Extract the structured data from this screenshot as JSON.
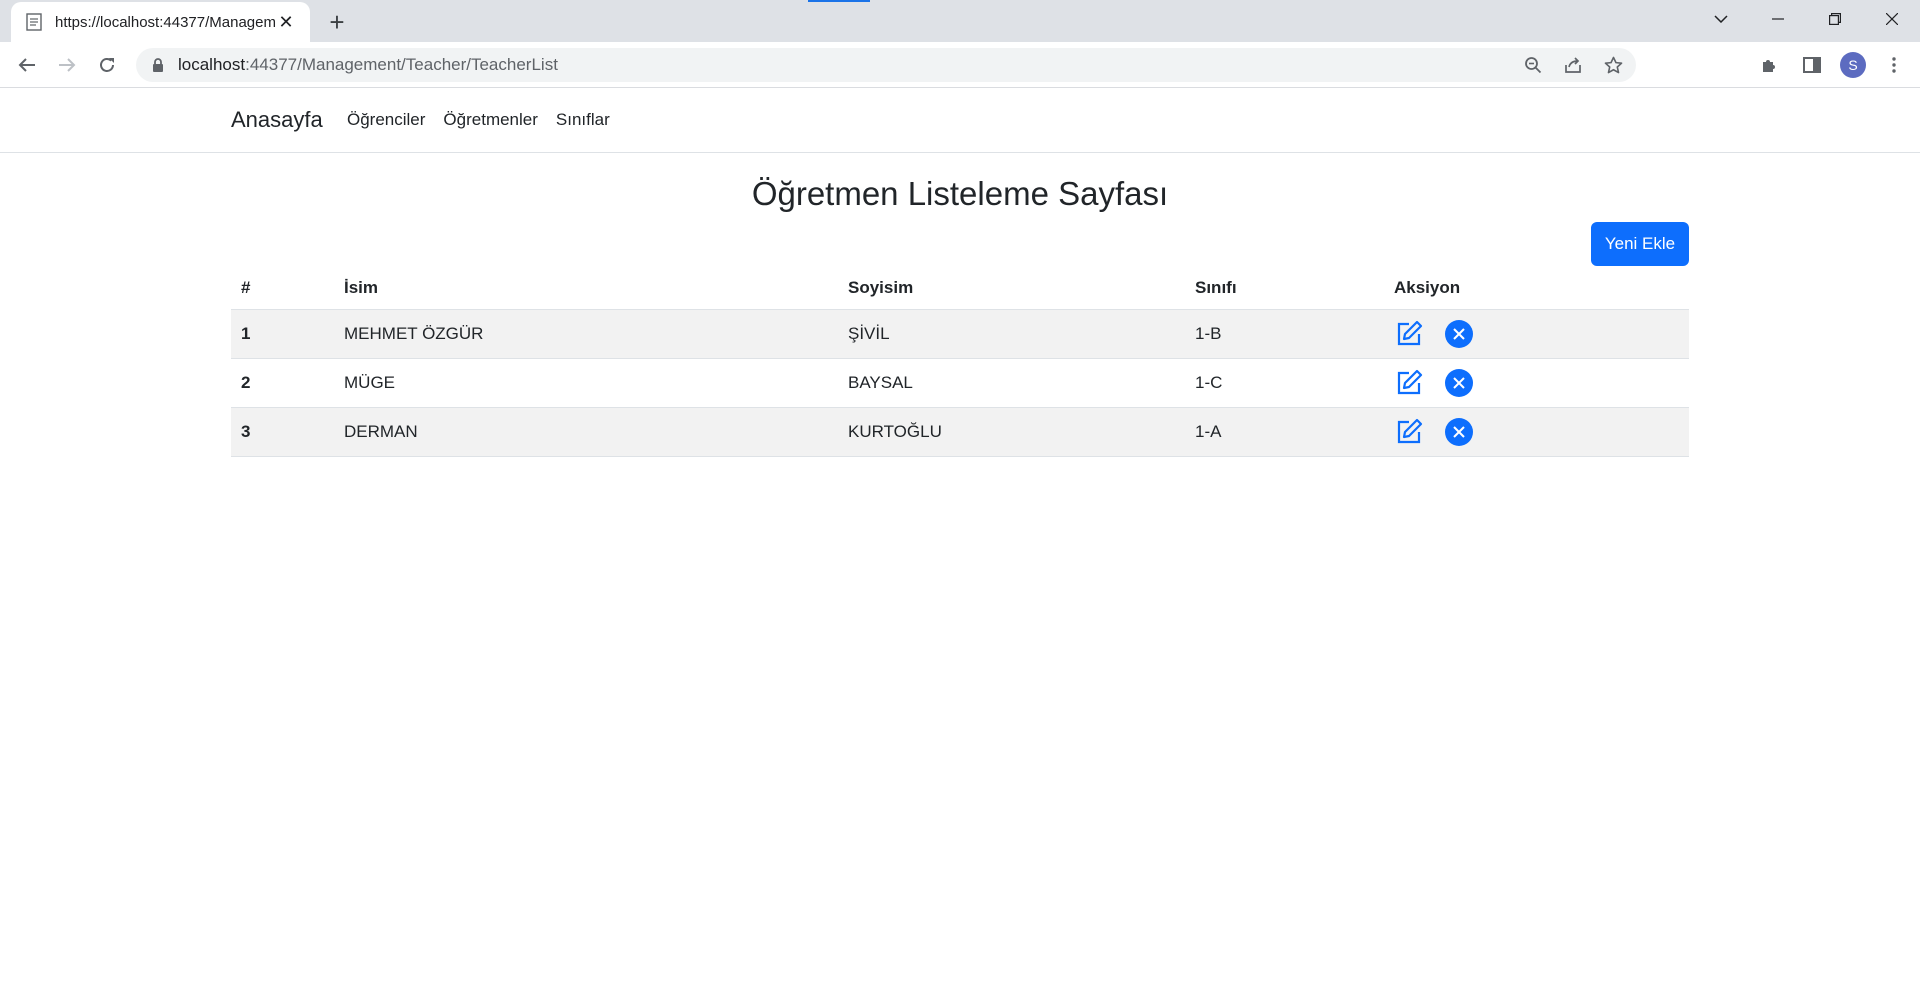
{
  "browser": {
    "tab_title": "https://localhost:44377/Management/Teacher/TeacherList",
    "url_host": "localhost",
    "url_path": ":44377/Management/Teacher/TeacherList",
    "avatar_letter": "S",
    "accent_color": "#1a73e8"
  },
  "navbar": {
    "brand": "Anasayfa",
    "links": [
      "Öğrenciler",
      "Öğretmenler",
      "Sınıflar"
    ]
  },
  "main": {
    "title": "Öğretmen Listeleme Sayfası",
    "add_button": "Yeni Ekle",
    "columns": [
      "#",
      "İsim",
      "Soyisim",
      "Sınıfı",
      "Aksiyon"
    ],
    "rows": [
      {
        "no": "1",
        "name": "MEHMET ÖZGÜR",
        "surname": "ŞİVİL",
        "class": "1-B"
      },
      {
        "no": "2",
        "name": "MÜGE",
        "surname": "BAYSAL",
        "class": "1-C"
      },
      {
        "no": "3",
        "name": "DERMAN",
        "surname": "KURTOĞLU",
        "class": "1-A"
      }
    ],
    "row_action_icons": [
      "edit-icon",
      "delete-icon"
    ],
    "primary_color": "#0d6efd"
  }
}
